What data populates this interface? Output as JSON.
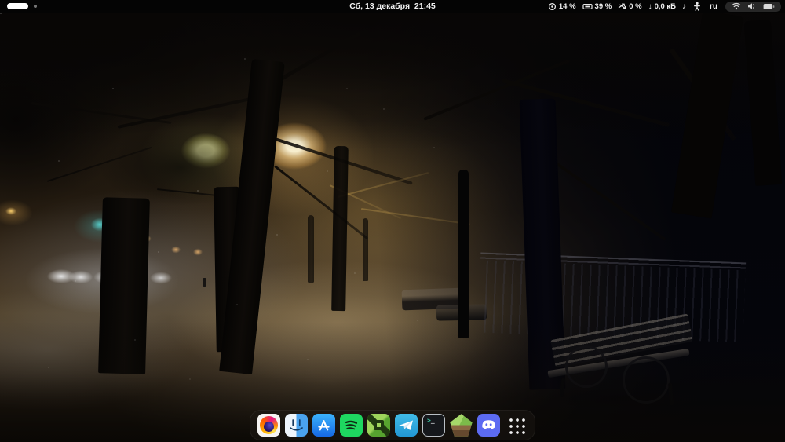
{
  "topbar": {
    "clock": "Сб, 13 декабря  21:45",
    "workspace_indicator": {
      "workspaces": 2,
      "active": 1
    },
    "system_monitor": {
      "cpu_percent": "14 %",
      "memory_percent": "39 %",
      "swap_percent": "0 %",
      "net_download": "0,0 кБ"
    },
    "keyboard_layout": "ru",
    "glyphs": {
      "music_note": "♪",
      "down_arrow": "↓",
      "terminal_prompt": ">",
      "terminal_cursor": "_"
    }
  },
  "dock": {
    "items": [
      {
        "id": "firefox"
      },
      {
        "id": "files"
      },
      {
        "id": "app-store"
      },
      {
        "id": "spotify"
      },
      {
        "id": "roblox-studio"
      },
      {
        "id": "telegram"
      },
      {
        "id": "terminal"
      },
      {
        "id": "minecraft-launcher"
      },
      {
        "id": "discord"
      },
      {
        "id": "app-grid"
      }
    ]
  },
  "wallpaper": {
    "description": "Night winter street: snowy tree-lined alley in fog, warm streetlights, snow-covered bench and railing at right, distant car headlights at left",
    "colors": {
      "lamp_warm": "#ffd9a0",
      "lamp_green": "#e8e8a8",
      "teal_light": "#45d5cf",
      "fog": "#8a7a58",
      "snow": "#b8ab94",
      "dark": "#0a0806"
    }
  }
}
